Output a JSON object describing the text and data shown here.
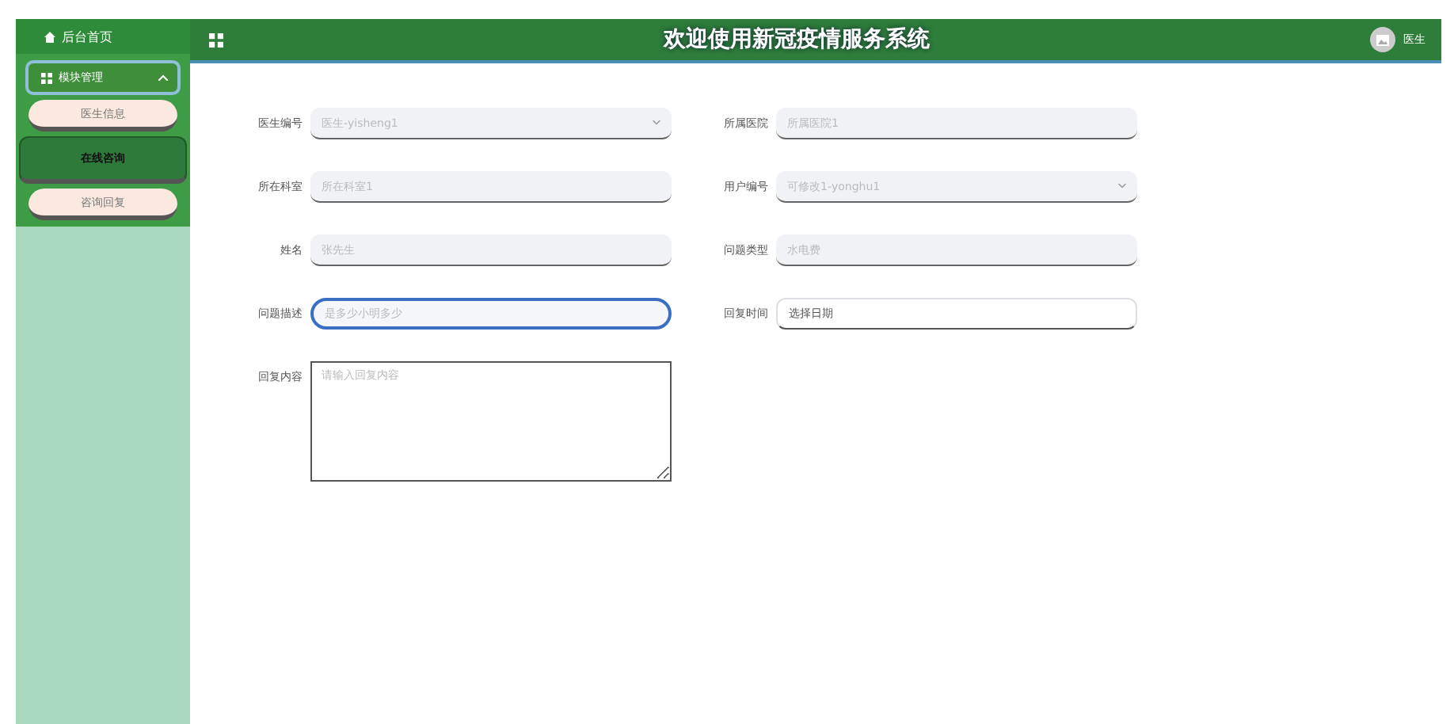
{
  "sidebar": {
    "home": "后台首页",
    "menu": {
      "label": "模块管理",
      "expanded": true
    },
    "items": [
      {
        "label": "医生信息",
        "selected": false
      },
      {
        "label": "在线咨询",
        "selected": true
      },
      {
        "label": "咨询回复",
        "selected": false
      }
    ]
  },
  "header": {
    "title": "欢迎使用新冠疫情服务系统",
    "user": "医生"
  },
  "form": {
    "rows": [
      [
        {
          "label": "医生编号",
          "kind": "select",
          "value": "医生-yisheng1",
          "disabled": true,
          "focused": false
        },
        {
          "label": "所属医院",
          "kind": "input",
          "value": "所属医院1",
          "disabled": true,
          "focused": false
        }
      ],
      [
        {
          "label": "所在科室",
          "kind": "input",
          "value": "所在科室1",
          "disabled": true,
          "focused": false
        },
        {
          "label": "用户编号",
          "kind": "select",
          "value": "可修改1-yonghu1",
          "disabled": true,
          "focused": false
        }
      ],
      [
        {
          "label": "姓名",
          "kind": "input",
          "value": "张先生",
          "disabled": true,
          "focused": false
        },
        {
          "label": "问题类型",
          "kind": "input",
          "value": "水电费",
          "disabled": true,
          "focused": false
        }
      ],
      [
        {
          "label": "问题描述",
          "kind": "input",
          "value": "是多少小明多少",
          "disabled": true,
          "focused": true
        },
        {
          "label": "回复时间",
          "kind": "date",
          "placeholder": "选择日期",
          "disabled": false,
          "focused": false
        }
      ],
      [
        {
          "label": "回复内容",
          "kind": "textarea",
          "placeholder": "请输入回复内容",
          "disabled": false,
          "focused": false
        }
      ]
    ]
  }
}
